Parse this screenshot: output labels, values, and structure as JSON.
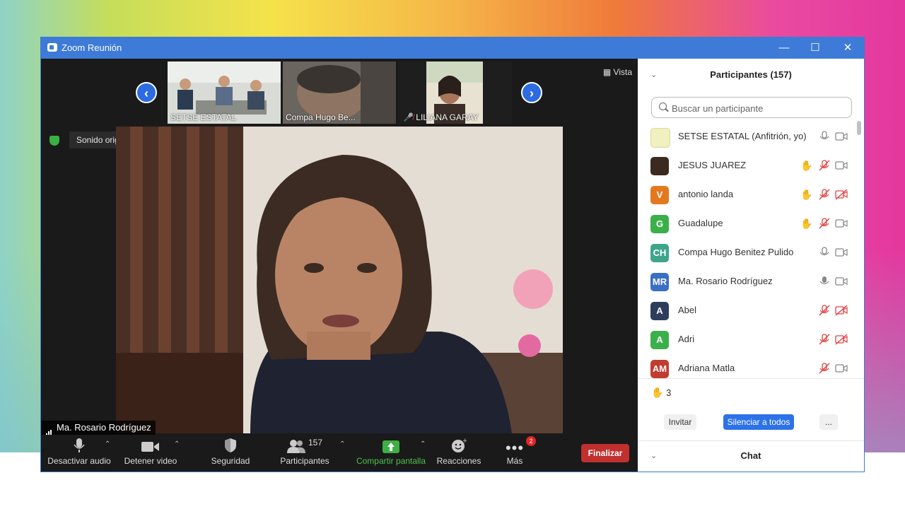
{
  "window": {
    "title": "Zoom Reunión",
    "controls": {
      "minimize": "—",
      "maximize": "☐",
      "close": "✕"
    }
  },
  "stage": {
    "view_button": "Vista",
    "original_sound": "Sonido original: desactivado",
    "active_speaker": "Ma. Rosario Rodríguez",
    "thumbnails": [
      {
        "label": "SETSE ESTATAL",
        "muted": false
      },
      {
        "label": "Compa Hugo Be...",
        "muted": false
      },
      {
        "label": "LILIANA GARAY",
        "muted": true
      }
    ]
  },
  "toolbar": {
    "mute": "Desactivar audio",
    "video": "Detener video",
    "security": "Seguridad",
    "participants": "Participantes",
    "participants_count": "157",
    "share": "Compartir pantalla",
    "reactions": "Reacciones",
    "more": "Más",
    "more_badge": "2",
    "end": "Finalizar"
  },
  "panel": {
    "title": "Participantes (157)",
    "search_placeholder": "Buscar un participante",
    "participants": [
      {
        "initials": "",
        "name": "SETSE ESTATAL (Anfitrión, yo)",
        "color": "#f0f0c0",
        "hand": false,
        "mic": "on",
        "cam": "on"
      },
      {
        "initials": "",
        "name": "JESUS JUAREZ",
        "color": "#3a2a1f",
        "hand": true,
        "mic": "off",
        "cam": "on"
      },
      {
        "initials": "V",
        "name": "antonio landa",
        "color": "#e2791f",
        "hand": true,
        "mic": "off",
        "cam": "off"
      },
      {
        "initials": "G",
        "name": "Guadalupe",
        "color": "#3bb04a",
        "hand": true,
        "mic": "off",
        "cam": "on"
      },
      {
        "initials": "CH",
        "name": "Compa Hugo Benitez Pulido",
        "color": "#3ea58c",
        "hand": false,
        "mic": "on",
        "cam": "on"
      },
      {
        "initials": "MR",
        "name": "Ma. Rosario Rodríguez",
        "color": "#3b6fc4",
        "hand": false,
        "mic": "active",
        "cam": "on"
      },
      {
        "initials": "A",
        "name": "Abel",
        "color": "#2f3d5c",
        "hand": false,
        "mic": "off",
        "cam": "off"
      },
      {
        "initials": "A",
        "name": "Adri",
        "color": "#3bb04a",
        "hand": false,
        "mic": "off",
        "cam": "off"
      },
      {
        "initials": "AM",
        "name": "Adriana Matla",
        "color": "#c23b2f",
        "hand": false,
        "mic": "off",
        "cam": "on"
      }
    ],
    "raised_hands": "3",
    "invite": "Invitar",
    "mute_all": "Silenciar a todos",
    "more": "...",
    "chat_title": "Chat"
  }
}
